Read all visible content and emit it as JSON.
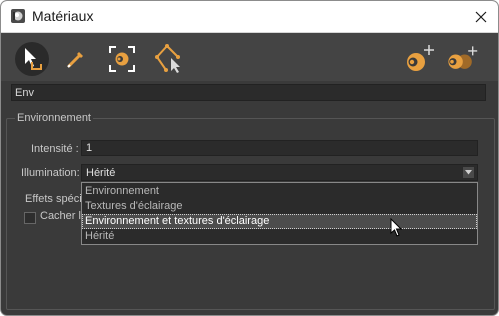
{
  "window": {
    "title": "Matériaux",
    "close_icon": "close-icon"
  },
  "toolbar": {
    "tools": [
      {
        "name": "select-material-tool",
        "icon": "cursor-arrow-icon"
      },
      {
        "name": "eyedropper-tool",
        "icon": "eyedropper-icon"
      },
      {
        "name": "pick-material-tool",
        "icon": "frame-sphere-icon"
      },
      {
        "name": "select-object-tool",
        "icon": "polygon-cursor-icon"
      },
      {
        "name": "new-material-tool",
        "icon": "sphere-plus-icon"
      },
      {
        "name": "duplicate-material-tool",
        "icon": "spheres-plus-icon"
      }
    ],
    "accent": "#e8a040"
  },
  "material_name": "Env",
  "environment": {
    "group_title": "Environnement",
    "intensity_label": "Intensité :",
    "intensity_value": "1",
    "illumination_label": "Illumination:",
    "illumination_value": "Hérité",
    "effects_label": "Effets spéci",
    "hide_label": "Cacher la"
  },
  "dropdown": {
    "options": [
      "Environnement",
      "Textures d'éclairage",
      "Environnement et textures d'éclairage",
      "Hérité"
    ],
    "hovered_index": 2
  }
}
